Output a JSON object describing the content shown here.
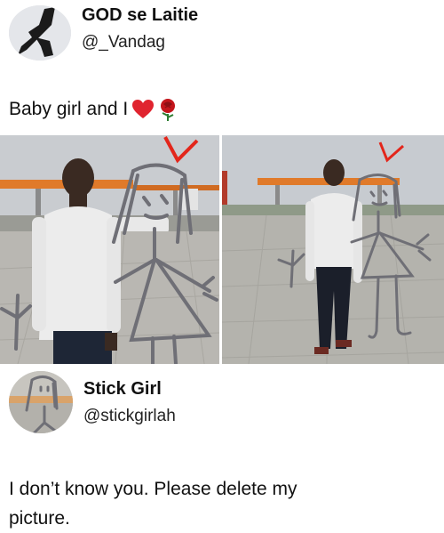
{
  "tweet1": {
    "name": "GOD se Laitie",
    "handle": "@_Vandag",
    "text": "Baby girl and I",
    "emoji": [
      "heart-emoji",
      "rose-emoji"
    ]
  },
  "photos": {
    "left": "man-with-stick-girl-drawing-left",
    "right": "man-with-stick-girl-drawing-right"
  },
  "tweet2": {
    "name": "Stick Girl",
    "handle": "@stickgirlah",
    "text_line1": "I don’t know you. Please delete my",
    "text_line2": "picture."
  },
  "colors": {
    "text": "#111111",
    "heart": "#e0242f",
    "rose": "#c4161c",
    "stick_drawing": "#6f6f76",
    "crown": "#e3261b"
  }
}
